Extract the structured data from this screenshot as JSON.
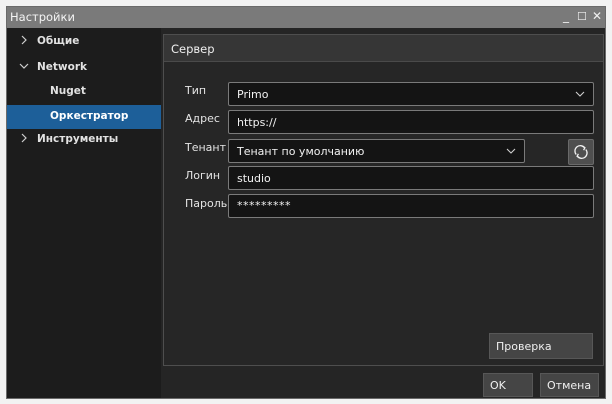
{
  "window": {
    "title": "Настройки",
    "controls": {
      "minimize": "_",
      "maximize": "☐",
      "close": "✕"
    }
  },
  "sidebar": {
    "items": [
      {
        "label": "Общие",
        "expander": "collapsed"
      },
      {
        "label": "Network",
        "expander": "expanded"
      },
      {
        "label": "Nuget",
        "expander": "none"
      },
      {
        "label": "Оркестратор",
        "expander": "none",
        "selected": true
      },
      {
        "label": "Инструменты",
        "expander": "collapsed"
      }
    ]
  },
  "panel": {
    "title": "Сервер",
    "fields": {
      "type": {
        "label": "Тип",
        "value": "Primo",
        "kind": "dropdown"
      },
      "address": {
        "label": "Адрес",
        "value": "https://",
        "kind": "text"
      },
      "tenant": {
        "label": "Тенант",
        "value": "Тенант по умолчанию",
        "kind": "dropdown"
      },
      "login": {
        "label": "Логин",
        "value": "studio",
        "kind": "text"
      },
      "password": {
        "label": "Пароль",
        "value": "*********",
        "kind": "password"
      }
    },
    "refresh_icon": "refresh-icon",
    "check_label": "Проверка"
  },
  "footer": {
    "ok_label": "OK",
    "cancel_label": "Отмена"
  },
  "colors": {
    "window_bg": "#252525",
    "sidebar_bg": "#1c1c1c",
    "selected_bg": "#1d5f99",
    "titlebar_bg": "#7a7a7a",
    "field_bg": "#141414",
    "field_border": "#7a7a7a",
    "button_bg": "#454545"
  }
}
